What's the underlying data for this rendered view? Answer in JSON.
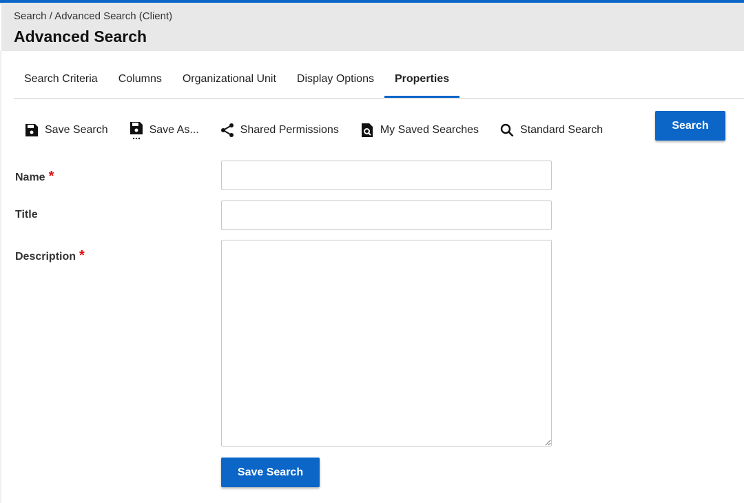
{
  "header": {
    "breadcrumb": "Search / Advanced Search (Client)",
    "title": "Advanced Search"
  },
  "tabs": [
    {
      "label": "Search Criteria"
    },
    {
      "label": "Columns"
    },
    {
      "label": "Organizational Unit"
    },
    {
      "label": "Display Options"
    },
    {
      "label": "Properties",
      "active": true
    }
  ],
  "toolbar": {
    "save_search": "Save Search",
    "save_as": "Save As...",
    "shared_permissions": "Shared Permissions",
    "my_saved_searches": "My Saved Searches",
    "standard_search": "Standard Search",
    "search_button": "Search"
  },
  "form": {
    "name_label": "Name",
    "title_label": "Title",
    "description_label": "Description",
    "required_mark": "*",
    "name_value": "",
    "title_value": "",
    "description_value": "",
    "save_button": "Save Search"
  },
  "colors": {
    "accent": "#0b66c8",
    "required": "#dd1111"
  }
}
